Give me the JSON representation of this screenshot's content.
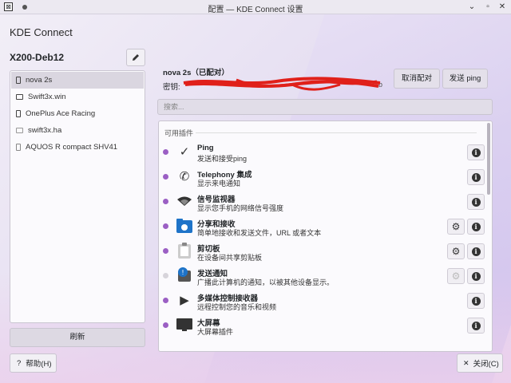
{
  "window": {
    "title": "配置 — KDE Connect 设置",
    "app_icon": "kde-connect-icon"
  },
  "app_title": "KDE Connect",
  "host_name": "X200-Deb12",
  "devices": [
    {
      "name": "nova 2s",
      "icon": "phone-icon",
      "selected": true
    },
    {
      "name": "Swift3x.win",
      "icon": "laptop-icon",
      "selected": false
    },
    {
      "name": "OnePlus Ace Racing",
      "icon": "phone-icon",
      "selected": false
    },
    {
      "name": "swift3x.ha",
      "icon": "tv-icon",
      "selected": false
    },
    {
      "name": "AQUOS R compact SHV41",
      "icon": "phone-icon",
      "selected": false
    }
  ],
  "buttons": {
    "refresh": "刷新",
    "help": "帮助(H)",
    "close": "关闭(C)",
    "unpair": "取消配对",
    "ping": "发送 ping"
  },
  "peer": {
    "name": "nova 2s（已配对）",
    "key_label": "密钥:",
    "key_value": "b",
    "key_redacted": true
  },
  "search": {
    "placeholder": "搜索..."
  },
  "plugins_header": "可用插件",
  "plugins": [
    {
      "name": "Ping",
      "desc": "发送和接受ping",
      "enabled": true,
      "icon": "checkmark-icon",
      "configurable": false
    },
    {
      "name": "Telephony 集成",
      "desc": "显示来电通知",
      "enabled": true,
      "icon": "phone-handset-icon",
      "configurable": false
    },
    {
      "name": "信号监视器",
      "desc": "显示您手机的网络信号强度",
      "enabled": true,
      "icon": "wifi-signal-icon",
      "configurable": false
    },
    {
      "name": "分享和接收",
      "desc": "简单地接收和发送文件，URL 或者文本",
      "enabled": true,
      "icon": "folder-share-icon",
      "configurable": true
    },
    {
      "name": "剪切板",
      "desc": "在设备间共享剪贴板",
      "enabled": true,
      "icon": "clipboard-icon",
      "configurable": true
    },
    {
      "name": "发送通知",
      "desc": "广播此计算机的通知，以被其他设备显示。",
      "enabled": false,
      "icon": "notification-icon",
      "configurable": true
    },
    {
      "name": "多媒体控制接收器",
      "desc": "远程控制您的音乐和视频",
      "enabled": true,
      "icon": "play-icon",
      "configurable": false
    },
    {
      "name": "大屏幕",
      "desc": "大屏幕插件",
      "enabled": true,
      "icon": "monitor-icon",
      "configurable": false
    }
  ],
  "colors": {
    "accent": "#9b5fc4",
    "redaction": "#e0201a"
  }
}
